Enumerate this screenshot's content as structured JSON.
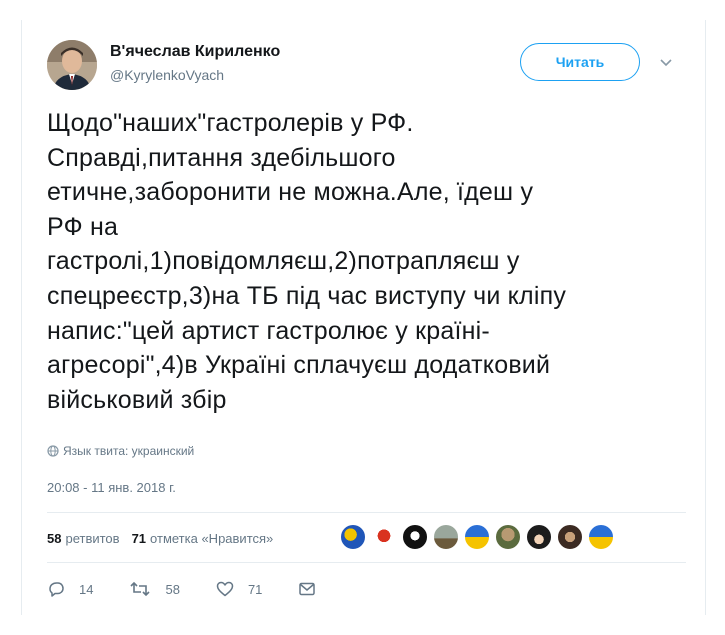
{
  "author": {
    "name": "В'ячеслав Кириленко",
    "handle": "@KyrylenkoVyach"
  },
  "follow_label": "Читать",
  "tweet": {
    "lines": [
      "Щодо\"наших\"гастролерів у РФ.",
      "Справді,питання здебільшого",
      "етичне,заборонити не можна.Але, їдеш у",
      "РФ на",
      "гастролі,1)повідомляєш,2)потрапляєш у",
      "спецреєстр,3)на ТБ під час виступу чи кліпу",
      "напис:\"цей артист гастролює у країні-",
      "агресорі\",4)в Україні сплачуєш додатковий",
      "військовий збір"
    ],
    "language_label": "Язык твита: украинский",
    "timestamp": "20:08 - 11 янв. 2018 г."
  },
  "stats": {
    "retweets_count": "58",
    "retweets_label": "ретвитов",
    "likes_count": "71",
    "likes_label": "отметка «Нравится»"
  },
  "actions": {
    "reply_count": "14",
    "retweet_count": "58",
    "like_count": "71"
  },
  "colors": {
    "accent": "#1da1f2",
    "text": "#14171a",
    "muted": "#657786",
    "divider": "#e6ecf0"
  }
}
